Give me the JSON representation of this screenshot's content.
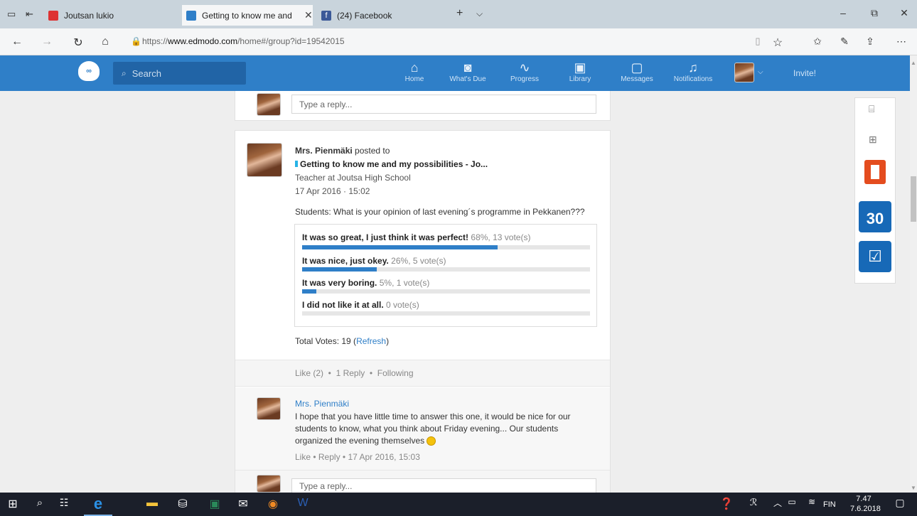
{
  "browser": {
    "tabs": [
      {
        "label": "Joutsan lukio"
      },
      {
        "label": "Getting to know me and"
      },
      {
        "label": "(24) Facebook"
      }
    ],
    "url_prefix": "https://",
    "url_domain": "www.edmodo.com",
    "url_rest": "/home#/group?id=19542015"
  },
  "header": {
    "search_placeholder": "Search",
    "nav": [
      {
        "label": "Home",
        "icon": "home-icon"
      },
      {
        "label": "What's Due",
        "icon": "calendar-icon"
      },
      {
        "label": "Progress",
        "icon": "pulse-icon"
      },
      {
        "label": "Library",
        "icon": "library-icon"
      },
      {
        "label": "Messages",
        "icon": "message-icon"
      },
      {
        "label": "Notifications",
        "icon": "bell-icon"
      }
    ],
    "invite": "Invite!"
  },
  "top_reply": {
    "placeholder": "Type a reply..."
  },
  "post": {
    "author": "Mrs. Pienmäki",
    "posted_to": "posted to",
    "group": "Getting to know me and my possibilities - Jo...",
    "role": "Teacher at Joutsa High School",
    "date": "17 Apr 2016 · 15:02",
    "question": "Students: What is your opinion of last evening´s programme in Pekkanen???",
    "poll": [
      {
        "option": "It was so great, I just think it was perfect!",
        "stats": "68%, 13 vote(s)",
        "fraction": 0.68
      },
      {
        "option": "It was nice, just okey.",
        "stats": "26%, 5 vote(s)",
        "fraction": 0.26
      },
      {
        "option": "It was very boring.",
        "stats": "5%, 1 vote(s)",
        "fraction": 0.05
      },
      {
        "option": "I did not like it at all.",
        "stats": "0 vote(s)",
        "fraction": 0
      }
    ],
    "total_label": "Total Votes: 19 (",
    "refresh": "Refresh",
    "total_close": ")",
    "like": "Like (2)",
    "reply": "1 Reply",
    "following": "Following"
  },
  "comment": {
    "author": "Mrs. Pienmäki",
    "text": "I hope that you have little time to answer this one, it would be nice for our students to know, what you think about Friday evening... Our students organized the evening themselves",
    "like": "Like",
    "reply": "Reply",
    "date": "17 Apr 2016, 15:03"
  },
  "bottom_reply": {
    "placeholder": "Type a reply..."
  },
  "side_apps": {
    "calendar_day": "30"
  },
  "taskbar": {
    "lang": "FIN",
    "time": "7.47",
    "date": "7.6.2018"
  }
}
